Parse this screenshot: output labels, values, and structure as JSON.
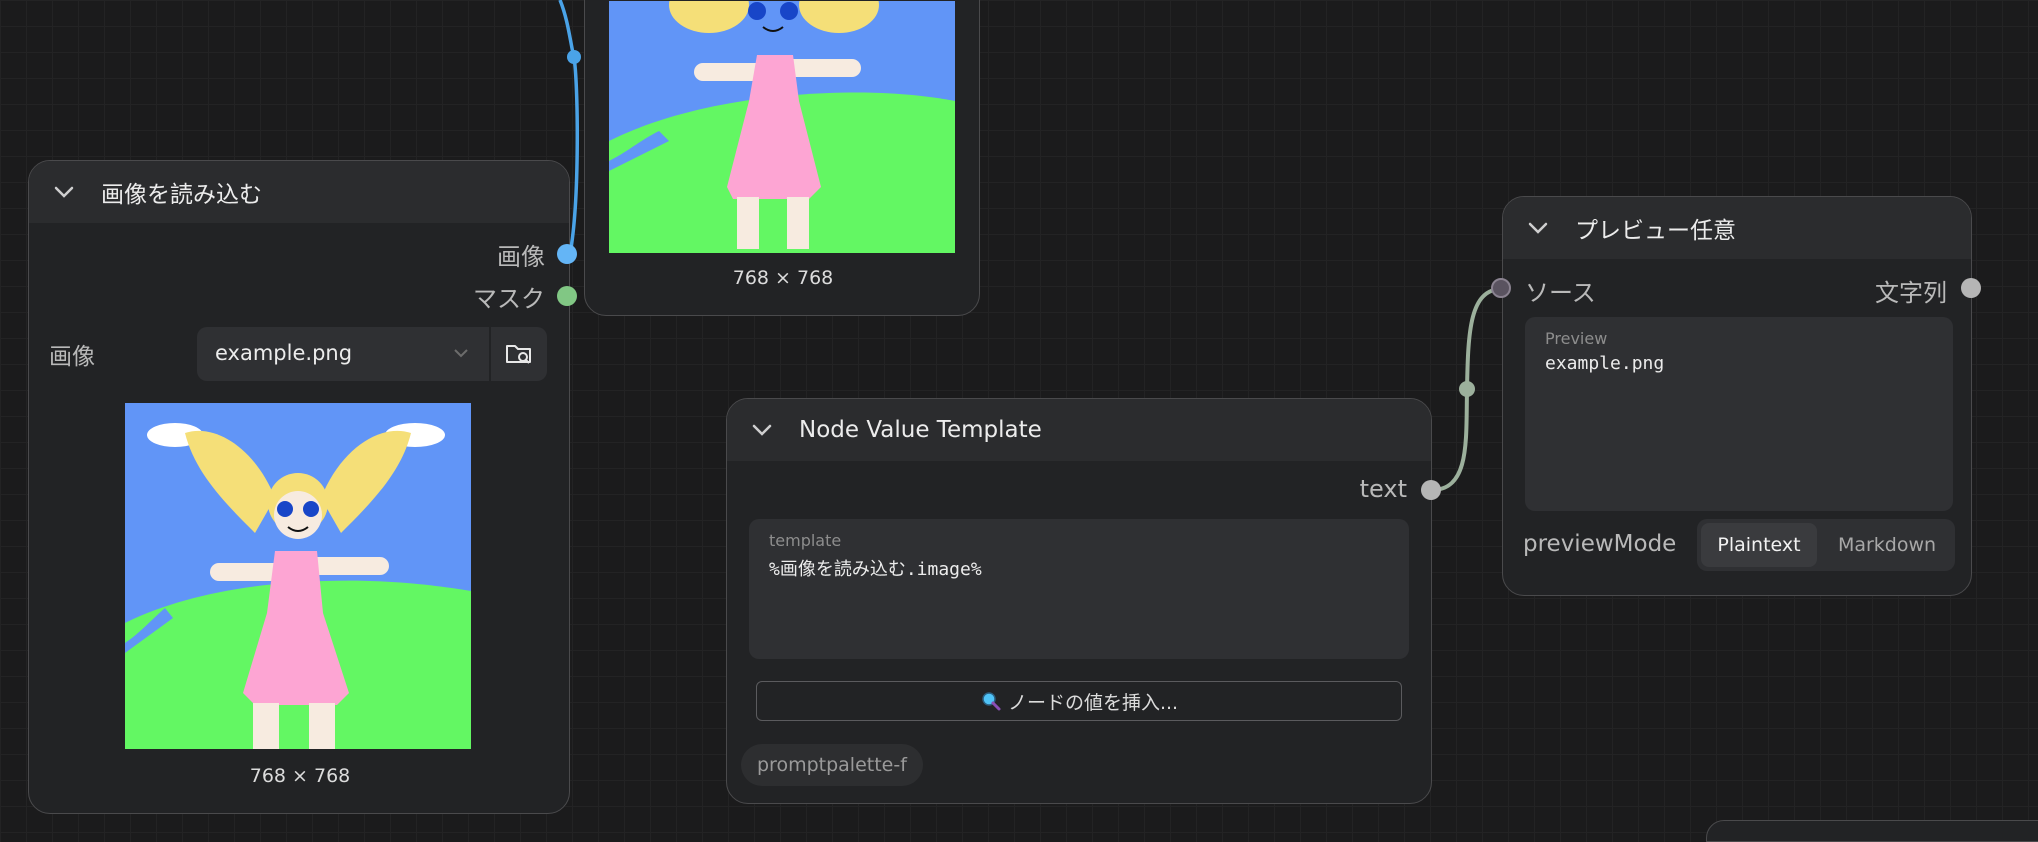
{
  "load_image_node": {
    "title": "画像を読み込む",
    "output_image": "画像",
    "output_mask": "マスク",
    "widget_label": "画像",
    "file_value": "example.png",
    "dimensions": "768 × 768"
  },
  "top_preview_node": {
    "dimensions": "768 × 768"
  },
  "template_node": {
    "title": "Node Value Template",
    "output_text": "text",
    "template_label": "template",
    "template_value": "%画像を読み込む.image%",
    "insert_button": "ノードの値を挿入...",
    "badge": "promptpalette-f"
  },
  "preview_any_node": {
    "title": "プレビュー任意",
    "input_source": "ソース",
    "output_string": "文字列",
    "preview_label": "Preview",
    "preview_value": "example.png",
    "mode_label": "previewMode",
    "mode_options": [
      "Plaintext",
      "Markdown"
    ],
    "mode_selected": "Plaintext"
  },
  "colors": {
    "image_slot": "#64b5f6",
    "mask_slot": "#81c784",
    "string_slot": "#b5b5b5",
    "any_slot": "#5a5360",
    "link_image": "#4aa3e8",
    "link_string": "#9cb09c"
  }
}
